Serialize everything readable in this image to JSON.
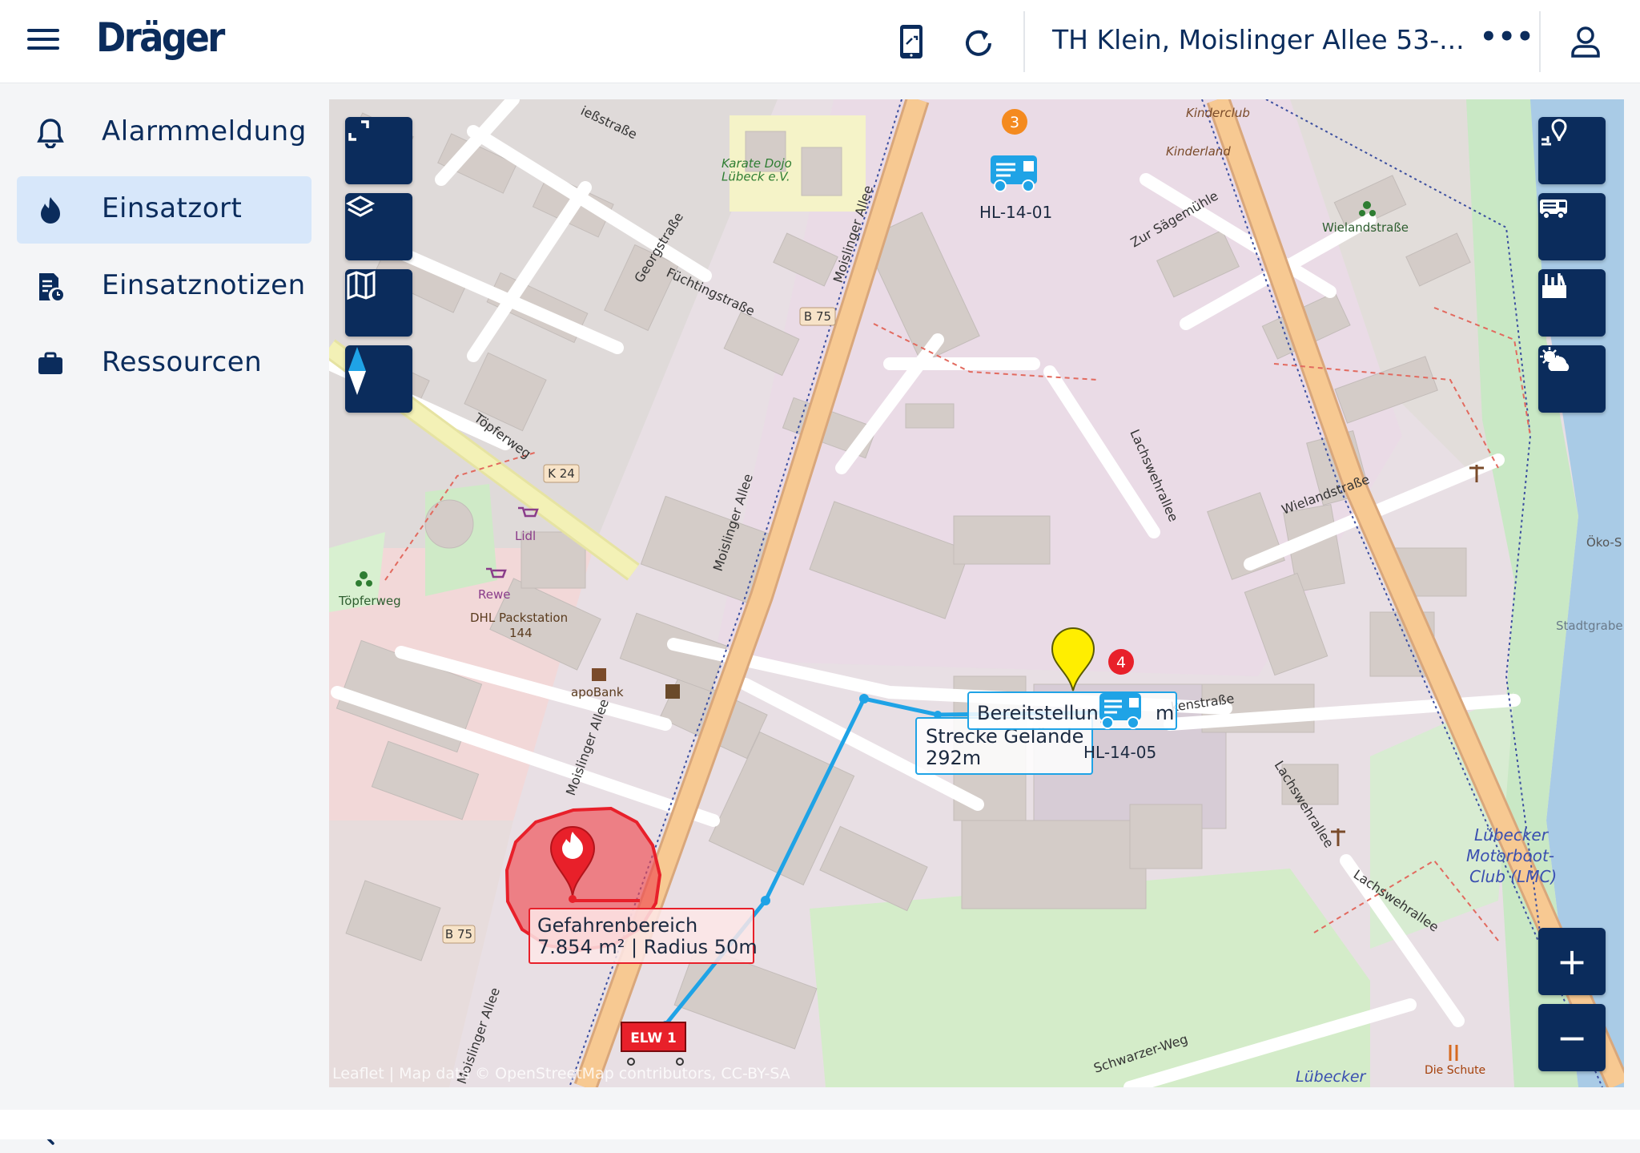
{
  "header": {
    "brand": "Dräger",
    "mission_title": "TH Klein, Moislinger Allee 53-...",
    "more_label": "•••"
  },
  "sidebar": {
    "items": [
      {
        "label": "Alarmmeldung",
        "icon": "bell-icon"
      },
      {
        "label": "Einsatzort",
        "icon": "flame-icon",
        "active": true
      },
      {
        "label": "Einsatznotizen",
        "icon": "note-clock-icon"
      },
      {
        "label": "Ressourcen",
        "icon": "briefcase-icon"
      }
    ],
    "collapse_label": "‹"
  },
  "map": {
    "streets": {
      "moislinger_allee": "Moislinger Allee",
      "moislinger_allee_2": "Moislinger Allee",
      "moislinger_allee_3": "Moislinger Allee",
      "moislinger_allee_4": "Moislinger Allee",
      "lachswehrallee": "Lachswehrallee",
      "lachswehrallee_2": "Lachswehrallee",
      "lachswehrallee_3": "Lachswehrallee",
      "toepferweg": "Töpferweg",
      "fuechtingstrasse": "Füchtingstraße",
      "georgstrasse": "Georgstraße",
      "wielandstrasse": "Wielandstraße",
      "schwarzer_weg": "Schwarzer-Weg",
      "zur_saegemuehle": "Zur Sägemühle",
      "elssstrasse": "ießstraße",
      "kensstrasse": "kenstraße",
      "luebecker": "Lübecker"
    },
    "shields": {
      "b75": "B 75",
      "b75_2": "B 75",
      "k24": "K 24"
    },
    "pois": {
      "karate": "Karate Dojo\nLübeck e.V.",
      "kinderclub": "Kinderclub",
      "kinderland": "Kinderland",
      "wielandstrasse_poi": "Wielandstraße",
      "lidl": "Lidl",
      "rewe": "Rewe",
      "dhl": "DHL Packstation",
      "dhl_num": "144",
      "apobank": "apoBank",
      "toepferweg_poi": "Töpferweg",
      "oeko": "Öko-S",
      "stadtgraben": "Stadtgrabe",
      "lmc_1": "Lübecker",
      "lmc_2": "Motorboot-",
      "lmc_3": "Club (LMC)",
      "die_schute": "Die Schute"
    },
    "vehicles": {
      "v1": "HL-14-01",
      "v2": "HL-14-05",
      "elw": "ELW 1"
    },
    "badges": {
      "orange": "3",
      "red": "4"
    },
    "labels": {
      "bereitstellung": "Bereitstellung",
      "bereitstellung_tail": "m",
      "strecke_1": "Strecke Gelände",
      "strecke_2": "292m",
      "gefahr_1": "Gefahrenbereich",
      "gefahr_2": "7.854 m² | Radius 50m"
    },
    "attribution": "Leaflet | Map data © OpenStreetMap contributors, CC-BY-SA",
    "controls": {
      "zoom_in": "+",
      "zoom_out": "−"
    },
    "colors": {
      "danger": "#e8202a",
      "route": "#1fa3e6",
      "marker": "#ffee00",
      "nav": "#0b2c5c"
    }
  }
}
